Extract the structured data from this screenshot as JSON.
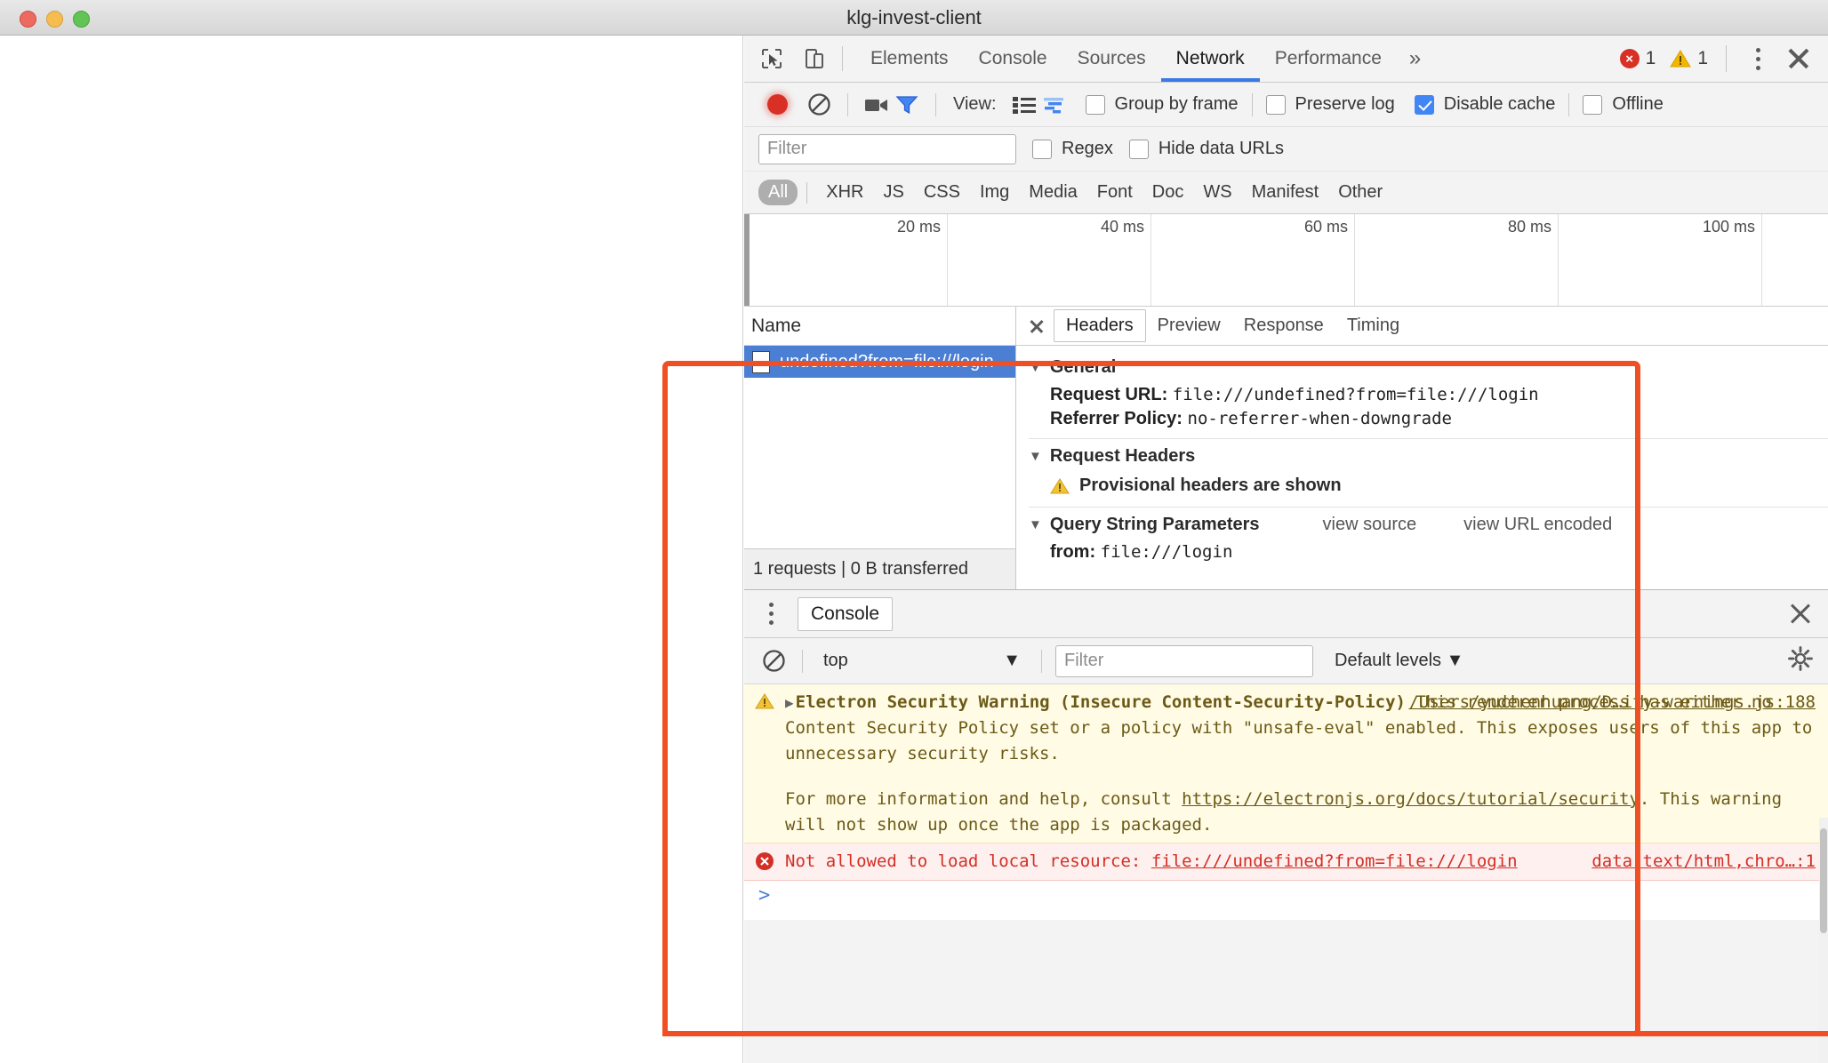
{
  "window": {
    "title": "klg-invest-client",
    "traffic_lights": [
      "close-button",
      "minimize-button",
      "zoom-button"
    ]
  },
  "devtools": {
    "main_tabs": [
      {
        "label": "Elements",
        "active": false
      },
      {
        "label": "Console",
        "active": false
      },
      {
        "label": "Sources",
        "active": false
      },
      {
        "label": "Network",
        "active": true
      },
      {
        "label": "Performance",
        "active": false
      }
    ],
    "more_tabs_glyph": "»",
    "error_count": "1",
    "warning_count": "1",
    "accent_color": "#3a79e6",
    "error_color": "#d93025",
    "warning_color": "#f2b600"
  },
  "network_toolbar": {
    "record_title": "record-button",
    "clear_title": "clear-button",
    "capture_screenshots_title": "camera-button",
    "filter_toggle_title": "filter-button",
    "view_label": "View:",
    "view_list_title": "list-view",
    "view_waterfall_title": "waterfall-view",
    "group_by_frame": {
      "label": "Group by frame",
      "checked": false
    },
    "preserve_log": {
      "label": "Preserve log",
      "checked": false
    },
    "disable_cache": {
      "label": "Disable cache",
      "checked": true
    },
    "offline": {
      "label": "Offline",
      "checked": false
    }
  },
  "filter_bar": {
    "filter_placeholder": "Filter",
    "filter_value": "",
    "regex": {
      "label": "Regex",
      "checked": false
    },
    "hide_data_urls": {
      "label": "Hide data URLs",
      "checked": false
    }
  },
  "type_chips": [
    {
      "label": "All",
      "selected": true
    },
    {
      "label": "XHR",
      "selected": false
    },
    {
      "label": "JS",
      "selected": false
    },
    {
      "label": "CSS",
      "selected": false
    },
    {
      "label": "Img",
      "selected": false
    },
    {
      "label": "Media",
      "selected": false
    },
    {
      "label": "Font",
      "selected": false
    },
    {
      "label": "Doc",
      "selected": false
    },
    {
      "label": "WS",
      "selected": false
    },
    {
      "label": "Manifest",
      "selected": false
    },
    {
      "label": "Other",
      "selected": false
    }
  ],
  "overview_ruler": {
    "ticks": [
      "20 ms",
      "40 ms",
      "60 ms",
      "80 ms",
      "100 ms"
    ]
  },
  "request_list": {
    "column_header": "Name",
    "rows": [
      {
        "name": "undefined?from=file:///login",
        "selected": true
      }
    ],
    "status_bar": "1 requests | 0 B transferred"
  },
  "detail_pane": {
    "tabs": [
      {
        "label": "Headers",
        "active": true
      },
      {
        "label": "Preview",
        "active": false
      },
      {
        "label": "Response",
        "active": false
      },
      {
        "label": "Timing",
        "active": false
      }
    ],
    "sections": [
      {
        "title": "General",
        "rows": [
          {
            "key": "Request URL:",
            "value": "file:///undefined?from=file:///login"
          },
          {
            "key": "Referrer Policy:",
            "value": "no-referrer-when-downgrade"
          }
        ]
      },
      {
        "title": "Request Headers",
        "warning": "Provisional headers are shown"
      },
      {
        "title": "Query String Parameters",
        "links": [
          "view source",
          "view URL encoded"
        ],
        "rows": [
          {
            "key": "from:",
            "value": "file:///login"
          }
        ]
      }
    ]
  },
  "drawer": {
    "tab_label": "Console",
    "clear_console_title": "clear-console-button",
    "context": "top",
    "filter_placeholder": "Filter",
    "filter_value": "",
    "levels_label": "Default levels",
    "settings_title": "console-settings-gear"
  },
  "console_messages": [
    {
      "level": "warning",
      "expandable": true,
      "bold_prefix": "Electron Security Warning (Insecure Content-Security-Policy)",
      "body": " This renderer process has either no Content Security Policy set or a policy with \"unsafe-eval\" enabled. This exposes users of this app to unnecessary security risks.",
      "body2_prefix": "For more information and help, consult ",
      "body2_link": "https://electronjs.org/docs/tutorial/security",
      "body2_suffix": ". This warning will not show up once the app is packaged.",
      "source": "/Users/yuchenhuang/D…ity-warnings.js:188"
    },
    {
      "level": "error",
      "expandable": false,
      "text_prefix": "Not allowed to load local resource: ",
      "text_link": "file:///undefined?from=file:///login",
      "source": "data:text/html,chro…:1"
    }
  ],
  "console_prompt": ">",
  "annotation": {
    "color": "#f04e23",
    "shape": "rectangle-highlight"
  }
}
